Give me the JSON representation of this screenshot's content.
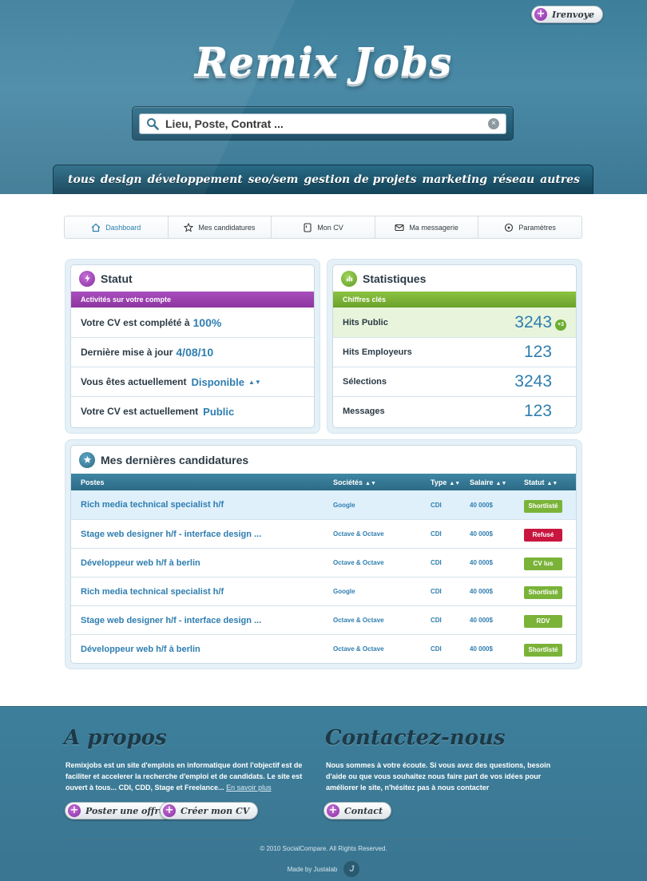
{
  "header": {
    "logo": "Remix Jobs",
    "login_button": "Irenvoye",
    "search": {
      "placeholder": "Lieu, Poste, Contrat ..."
    },
    "nav": [
      "tous",
      "design",
      "développement",
      "seo/sem",
      "gestion de projets",
      "marketing",
      "réseau",
      "autres"
    ]
  },
  "tabs": [
    {
      "label": "Dashboard",
      "icon": "home-icon"
    },
    {
      "label": "Mes candidatures",
      "icon": "star-icon"
    },
    {
      "label": "Mon CV",
      "icon": "cv-icon"
    },
    {
      "label": "Ma messagerie",
      "icon": "mail-icon"
    },
    {
      "label": "Paramètres",
      "icon": "settings-icon"
    }
  ],
  "statut": {
    "title": "Statut",
    "band": "Activités sur votre compte",
    "rows": [
      {
        "label": "Votre CV est complété à",
        "value": "100%"
      },
      {
        "label": "Dernière mise à jour",
        "value": "4/08/10"
      },
      {
        "label": "Vous êtes actuellement",
        "value": "Disponible"
      },
      {
        "label": "Votre CV est actuellement",
        "value": "Public"
      }
    ]
  },
  "stats": {
    "title": "Statistiques",
    "band": "Chiffres clés",
    "rows": [
      {
        "label": "Hits Public",
        "value": "3243",
        "badge": "+3"
      },
      {
        "label": "Hits Employeurs",
        "value": "123"
      },
      {
        "label": "Sélections",
        "value": "3243"
      },
      {
        "label": "Messages",
        "value": "123"
      }
    ]
  },
  "candidatures": {
    "title": "Mes dernières candidatures",
    "columns": [
      "Postes",
      "Sociétés",
      "Type",
      "Salaire",
      "Statut"
    ],
    "rows": [
      {
        "poste": "Rich media technical specialist h/f",
        "societe": "Google",
        "type": "CDI",
        "salaire": "40 000$",
        "statut": "Shortlisté"
      },
      {
        "poste": "Stage web designer h/f - interface design ...",
        "societe": "Octave & Octave",
        "type": "CDI",
        "salaire": "40 000$",
        "statut": "Refusé"
      },
      {
        "poste": "Développeur web h/f à berlin",
        "societe": "Octave & Octave",
        "type": "CDI",
        "salaire": "40 000$",
        "statut": "CV lus"
      },
      {
        "poste": "Rich media technical specialist h/f",
        "societe": "Google",
        "type": "CDI",
        "salaire": "40 000$",
        "statut": "Shortlisté"
      },
      {
        "poste": "Stage web designer h/f - interface design ...",
        "societe": "Octave & Octave",
        "type": "CDI",
        "salaire": "40 000$",
        "statut": "RDV"
      },
      {
        "poste": "Développeur web h/f à berlin",
        "societe": "Octave & Octave",
        "type": "CDI",
        "salaire": "40 000$",
        "statut": "Shortlisté"
      }
    ]
  },
  "footer": {
    "apropos_title": "A propos",
    "apropos_text": "Remixjobs est un site d'emplois en informatique dont l'objectif est de faciliter et accelerer la recherche d'emploi et de candidats. Le site est ouvert à tous... CDI, CDD, Stage et Freelance...",
    "apropos_link": "En savoir plus",
    "post_button": "Poster une offre",
    "cv_button": "Créer mon CV",
    "contact_title": "Contactez-nous",
    "contact_text": "Nous sommes à votre écoute. Si vous avez des questions, besoin d'aide ou que vous souhaitez nous faire part de vos idées pour améliorer le site, n'hésitez pas à nous contacter",
    "contact_button": "Contact",
    "copyright": "© 2010 SocialCompare. All Rights Reserved.",
    "made_by": "Made by Justalab"
  },
  "colors": {
    "header_blue": "#3d7f9b",
    "accent_blue": "#2f7eb0",
    "purple": "#9a3aae",
    "green": "#6aad32",
    "refused_red": "#c8163f"
  }
}
